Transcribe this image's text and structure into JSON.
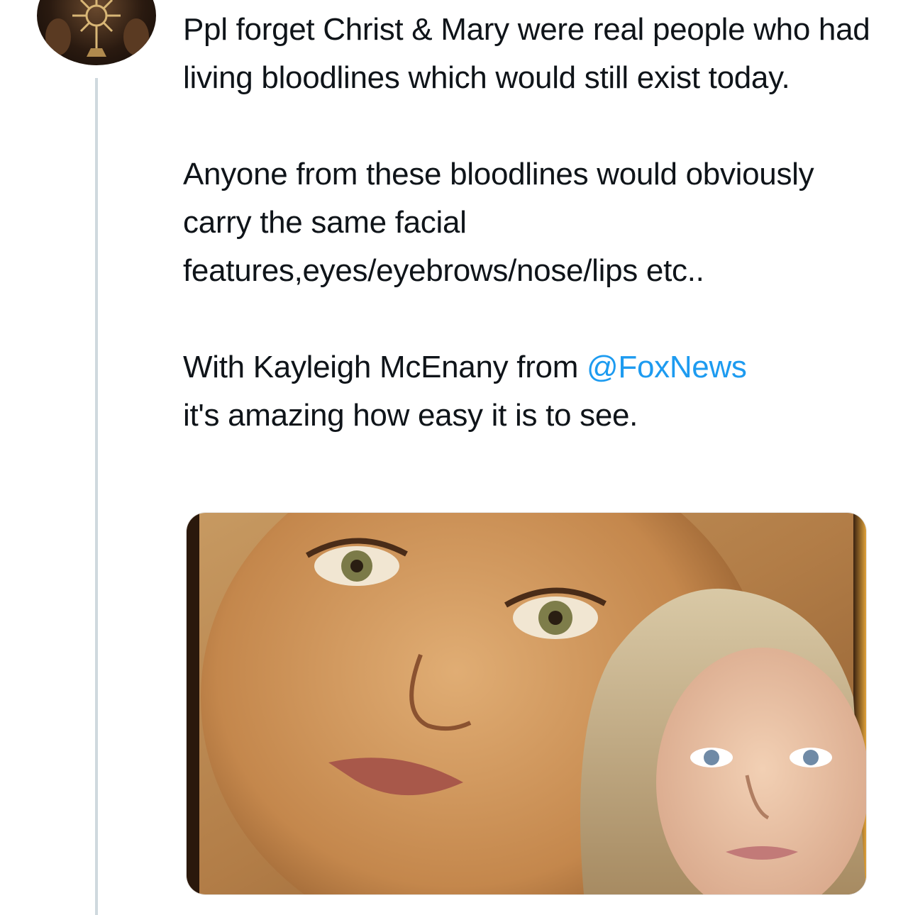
{
  "tweet": {
    "paragraphs": [
      "Ppl forget Christ & Mary were real people who had living bloodlines which would still exist today.",
      "Anyone from these bloodlines would obviously carry the same facial features,eyes/eyebrows/nose/lips etc..",
      "it's amazing how easy it is to see."
    ],
    "line3_prefix": "With Kayleigh McEnany from ",
    "mention": "@FoxNews"
  },
  "icons": {
    "avatar": "monstrance-avatar-icon"
  },
  "colors": {
    "mention": "#1d9bf0",
    "thread_line": "#cfd9de"
  }
}
